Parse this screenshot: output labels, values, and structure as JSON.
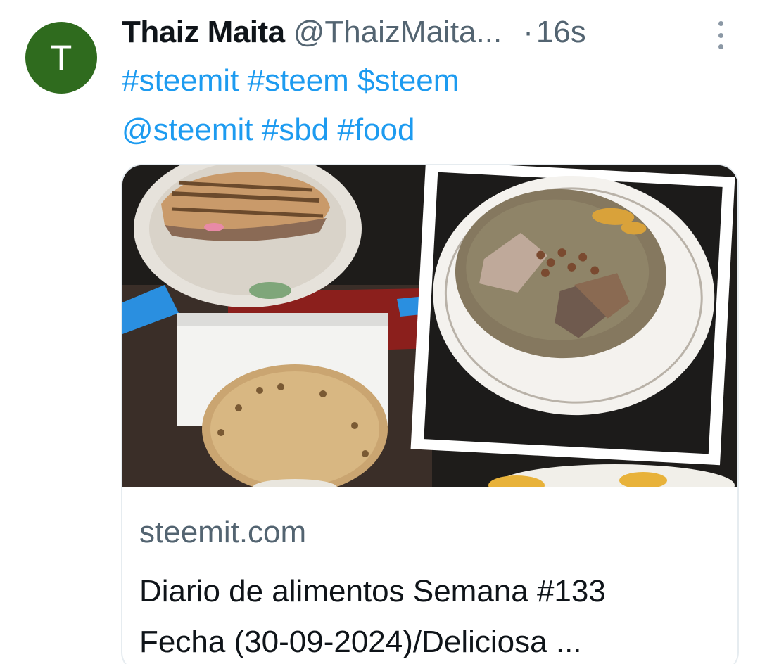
{
  "author": {
    "avatar_letter": "T",
    "avatar_color": "#2f6b1e",
    "display_name": "Thaiz Maita",
    "handle": "@ThaizMaita...",
    "separator": "·",
    "time": "16s"
  },
  "menu": {
    "icon": "more-vertical-icon"
  },
  "tweet": {
    "tokens": [
      "#steemit",
      "#steem",
      "$steem",
      "@steemit",
      "#sbd",
      "#food"
    ],
    "link_color": "#1d9bf0"
  },
  "card": {
    "image_icon": "food-collage-image",
    "domain": "steemit.com",
    "title_line1": "Diario de alimentos Semana #133",
    "title_line2": "Fecha (30-09-2024)/Deliciosa ..."
  }
}
